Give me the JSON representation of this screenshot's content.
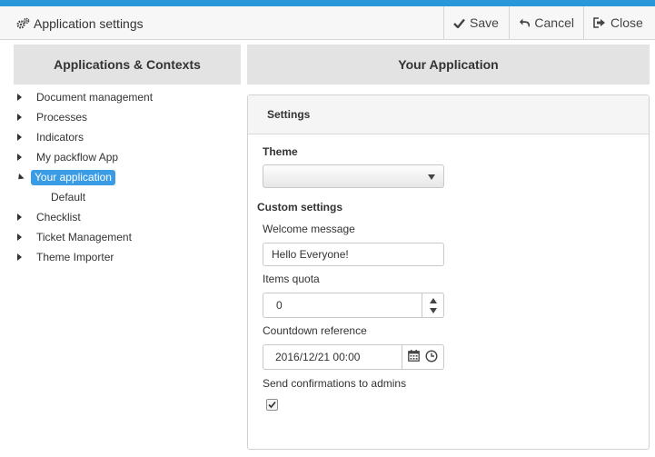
{
  "header": {
    "title": "Application settings",
    "icon": "gears-icon"
  },
  "toolbar": {
    "save": "Save",
    "cancel": "Cancel",
    "close": "Close"
  },
  "left": {
    "title": "Applications & Contexts",
    "items": [
      {
        "label": "Document management"
      },
      {
        "label": "Processes"
      },
      {
        "label": "Indicators"
      },
      {
        "label": "My packflow App"
      },
      {
        "label": "Your application",
        "child": "Default"
      },
      {
        "label": "Checklist"
      },
      {
        "label": "Ticket Management"
      },
      {
        "label": "Theme Importer"
      }
    ]
  },
  "right": {
    "title": "Your Application",
    "settings_title": "Settings",
    "theme_label": "Theme",
    "theme_value": "",
    "custom_settings_label": "Custom settings",
    "welcome_label": "Welcome message",
    "welcome_value": "Hello Everyone!",
    "quota_label": "Items quota",
    "quota_value": "0",
    "countdown_label": "Countdown reference",
    "countdown_value": "2016/12/21 00:00",
    "confirm_label": "Send confirmations to admins",
    "confirm_checked": true
  },
  "colors": {
    "accent": "#2a97d8",
    "selected": "#3a9ce4",
    "panel_header": "#e3e3e3"
  }
}
